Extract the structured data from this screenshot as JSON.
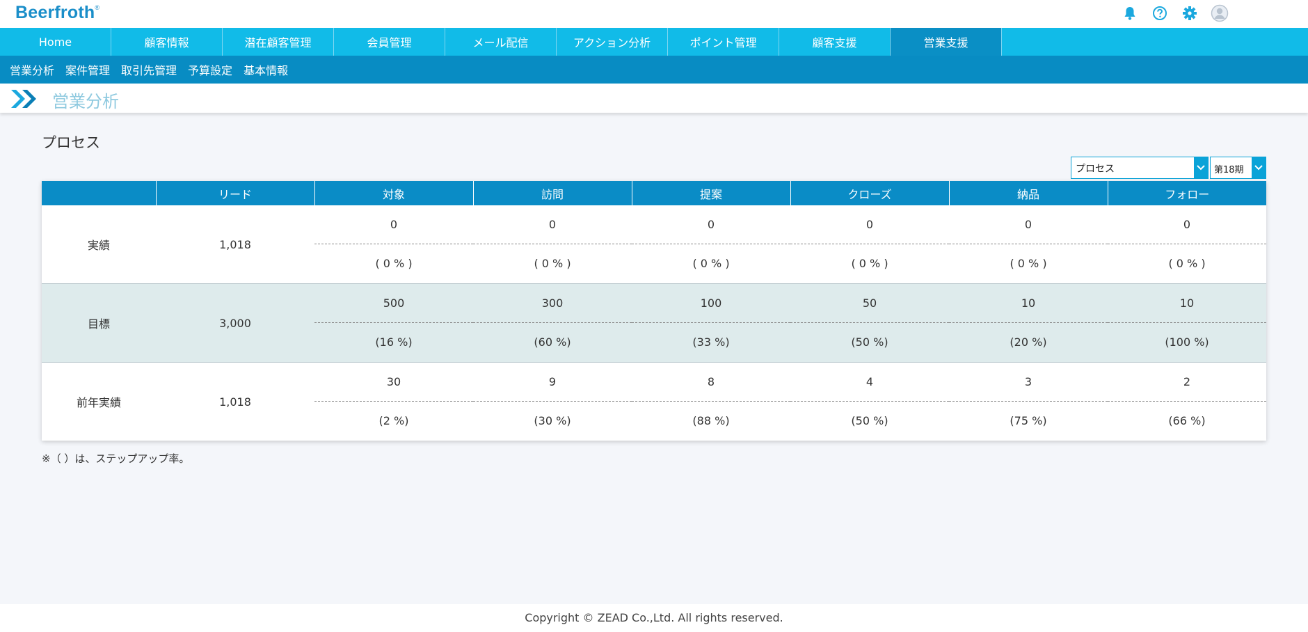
{
  "app": {
    "logo": "Beerfroth",
    "logo_mark": "®"
  },
  "top_icons": [
    "bell-icon",
    "help-icon",
    "gear-icon",
    "user-avatar-icon"
  ],
  "main_nav": [
    {
      "label": "Home"
    },
    {
      "label": "顧客情報"
    },
    {
      "label": "潜在顧客管理"
    },
    {
      "label": "会員管理"
    },
    {
      "label": "メール配信"
    },
    {
      "label": "アクション分析"
    },
    {
      "label": "ポイント管理"
    },
    {
      "label": "顧客支援"
    },
    {
      "label": "営業支援",
      "active": true
    }
  ],
  "sub_nav": [
    {
      "label": "営業分析"
    },
    {
      "label": "案件管理"
    },
    {
      "label": "取引先管理"
    },
    {
      "label": "予算設定"
    },
    {
      "label": "基本情報"
    }
  ],
  "page": {
    "title": "営業分析",
    "section_title": "プロセス"
  },
  "filters": {
    "type_select": "プロセス",
    "period_select": "第18期"
  },
  "table": {
    "headers": [
      "",
      "リード",
      "対象",
      "訪問",
      "提案",
      "クローズ",
      "納品",
      "フォロー"
    ],
    "rows": [
      {
        "label": "実績",
        "lead": "1,018",
        "values": [
          "0",
          "0",
          "0",
          "0",
          "0",
          "0"
        ],
        "rates": [
          "( 0 % )",
          "( 0 % )",
          "( 0 % )",
          "( 0 % )",
          "( 0 % )",
          "( 0 % )"
        ]
      },
      {
        "label": "目標",
        "lead": "3,000",
        "values": [
          "500",
          "300",
          "100",
          "50",
          "10",
          "10"
        ],
        "rates": [
          "(16 %)",
          "(60 %)",
          "(33 %)",
          "(50 %)",
          "(20 %)",
          "(100 %)"
        ]
      },
      {
        "label": "前年実績",
        "lead": "1,018",
        "values": [
          "30",
          "9",
          "8",
          "4",
          "3",
          "2"
        ],
        "rates": [
          "(2 %)",
          "(30 %)",
          "(88 %)",
          "(50 %)",
          "(75 %)",
          "(66 %)"
        ]
      }
    ]
  },
  "note": "※（ ）は、ステップアップ率。",
  "footer": "Copyright © ZEAD Co.,Ltd. All rights reserved.",
  "colors": {
    "main_nav": "#11bbe8",
    "main_nav_active": "#0a8fc5",
    "sub_nav": "#088cc3",
    "table_header": "#0a8cc6",
    "alt_row": "#deebec"
  }
}
